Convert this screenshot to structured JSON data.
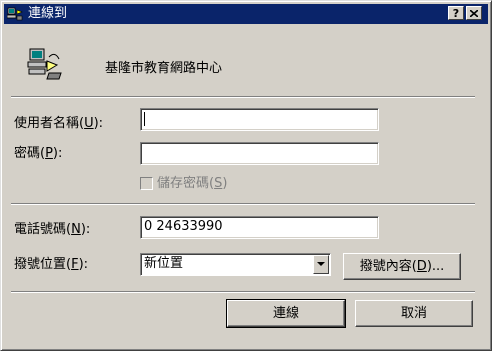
{
  "window": {
    "title": "連線到"
  },
  "title_buttons": {
    "help": "?",
    "close": "X"
  },
  "connection": {
    "name": "基隆市教育網路中心",
    "icon": "dialup-computer-icon"
  },
  "fields": {
    "username": {
      "label_prefix": "使用者名稱(",
      "hotkey": "U",
      "label_suffix": "):",
      "value": ""
    },
    "password": {
      "label_prefix": "密碼(",
      "hotkey": "P",
      "label_suffix": "):",
      "value": ""
    },
    "save_password": {
      "label_prefix": "儲存密碼(",
      "hotkey": "S",
      "label_suffix": ")",
      "checked": false,
      "disabled": true
    },
    "phone": {
      "label_prefix": "電話號碼(",
      "hotkey": "N",
      "label_suffix": "):",
      "value": "0 24633990"
    },
    "dial_from": {
      "label_prefix": "撥號位置(",
      "hotkey": "F",
      "label_suffix": "):",
      "value": "新位置"
    }
  },
  "buttons": {
    "dial_properties": {
      "label_prefix": "撥號內容(",
      "hotkey": "D",
      "label_suffix": ")..."
    },
    "connect": "連線",
    "cancel": "取消"
  },
  "colors": {
    "titlebar": "#0a246a",
    "face": "#d4d0c8"
  }
}
